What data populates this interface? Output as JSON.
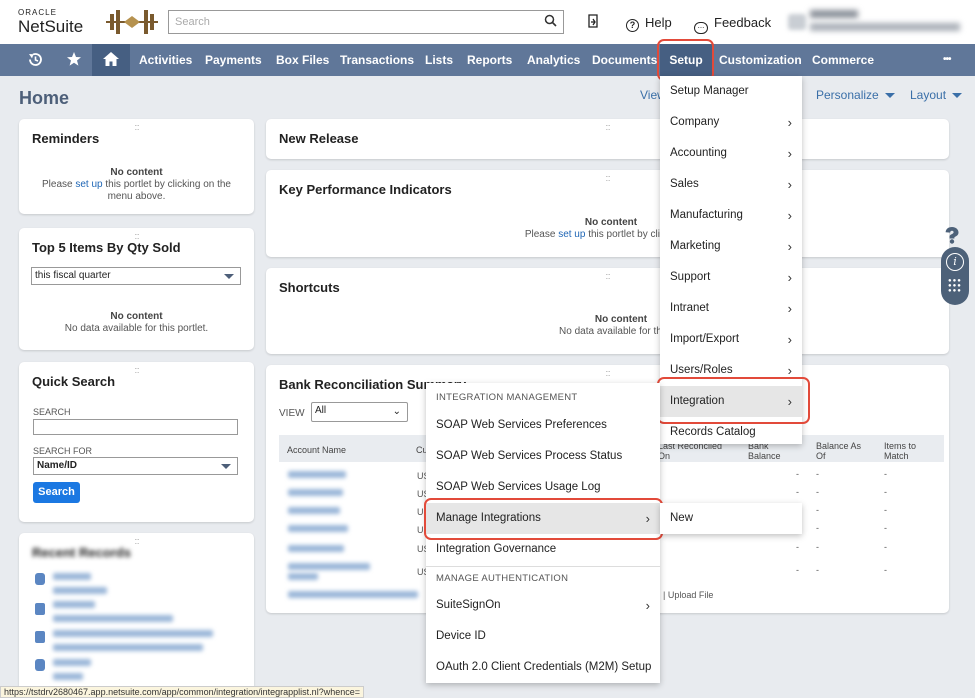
{
  "header": {
    "logo_oracle": "ORACLE",
    "logo_netsuite": "NetSuite",
    "search": {
      "placeholder": "Search",
      "value": ""
    },
    "help_label": "Help",
    "feedback_label": "Feedback"
  },
  "nav": {
    "items": [
      "Activities",
      "Payments",
      "Box Files",
      "Transactions",
      "Lists",
      "Reports",
      "Analytics",
      "Documents",
      "Setup",
      "Customization",
      "Commerce"
    ],
    "more": "•••",
    "active": "Setup"
  },
  "page": {
    "title": "Home",
    "view_link": "View",
    "personalize": "Personalize",
    "layout": "Layout"
  },
  "reminders": {
    "title": "Reminders",
    "no_content": "No content",
    "msg_pre": "Please",
    "msg_link": "set up",
    "msg_post": "this portlet by clicking on the menu above."
  },
  "top_items": {
    "title": "Top 5 Items By Qty Sold",
    "period": "this fiscal quarter",
    "no_content": "No content",
    "msg": "No data available for this portlet."
  },
  "quick_search": {
    "title": "Quick Search",
    "search_label": "SEARCH",
    "search_for_label": "SEARCH FOR",
    "search_for_value": "Name/ID",
    "button": "Search"
  },
  "recent_records": {
    "title": "Recent Records"
  },
  "new_release": {
    "title": "New Release"
  },
  "kpi": {
    "title": "Key Performance Indicators",
    "no_content": "No content",
    "msg_pre": "Please",
    "msg_link": "set up",
    "msg_post": "this portlet by clicking on"
  },
  "shortcuts": {
    "title": "Shortcuts",
    "no_content": "No content",
    "msg": "No data available for this po"
  },
  "bank_rec": {
    "title": "Bank Reconciliation Summary",
    "view_label": "VIEW",
    "view_value": "All",
    "col_account": "Account Name",
    "col_currency": "Cu",
    "col_reconciled": "Last Reconciled On",
    "col_bank_balance": "Bank Balance",
    "col_balance_as_of": "Balance As Of",
    "col_items_to_match": "Items to Match",
    "currency_prefix": "US",
    "dash": "-",
    "upload_link": "| Upload File"
  },
  "setup_menu": {
    "items": [
      "Setup Manager",
      "Company",
      "Accounting",
      "Sales",
      "Manufacturing",
      "Marketing",
      "Support",
      "Intranet",
      "Import/Export",
      "Users/Roles",
      "Integration",
      "Records Catalog"
    ]
  },
  "integration_menu": {
    "header_mgmt": "INTEGRATION MANAGEMENT",
    "items_mgmt": [
      "SOAP Web Services Preferences",
      "SOAP Web Services Process Status",
      "SOAP Web Services Usage Log",
      "Manage Integrations",
      "Integration Governance"
    ],
    "header_auth": "MANAGE AUTHENTICATION",
    "items_auth": [
      "SuiteSignOn",
      "Device ID",
      "OAuth 2.0 Client Credentials (M2M) Setup"
    ]
  },
  "manage_submenu": {
    "item": "New"
  },
  "status_url": "https://tstdrv2680467.app.netsuite.com/app/common/integration/integrapplist.nl?whence=",
  "colors": {
    "nav_bg": "#607799",
    "nav_active": "#465f82",
    "highlight": "#e24a3a",
    "link": "#1f66b5",
    "button": "#1b78e2"
  },
  "icons": [
    "search-icon",
    "recent-records-icon",
    "help-icon",
    "feedback-icon",
    "history-icon",
    "star-icon",
    "home-icon",
    "chevron-right-icon",
    "dropdown-caret-icon",
    "question-icon",
    "info-icon",
    "grid-icon"
  ]
}
